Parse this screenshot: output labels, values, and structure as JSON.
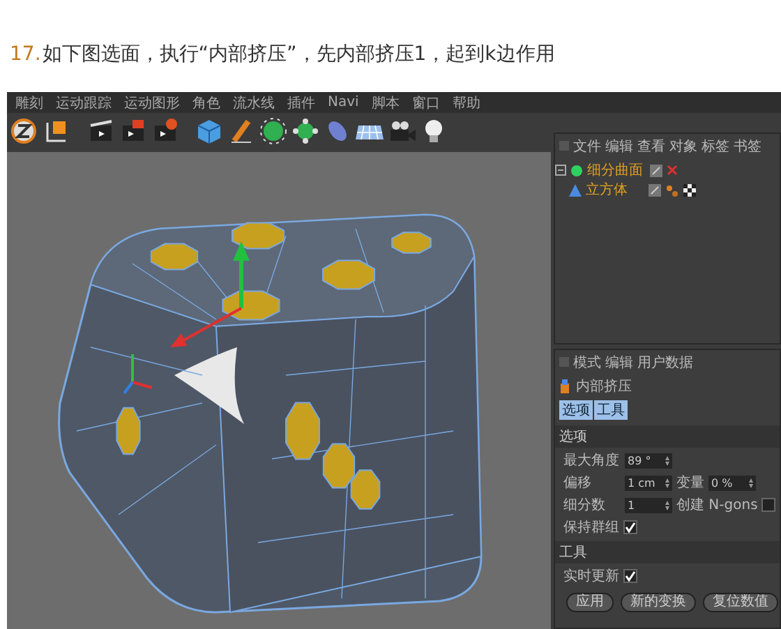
{
  "caption": {
    "number": "17.",
    "text": "如下图选面，执行“内部挤压”，先内部挤压1，起到k边作用"
  },
  "menu_bar": [
    "雕刻",
    "运动跟踪",
    "运动图形",
    "角色",
    "流水线",
    "插件",
    "Navi",
    "脚本",
    "窗口",
    "帮助"
  ],
  "object_manager": {
    "menu": [
      "文件",
      "编辑",
      "查看",
      "对象",
      "标签",
      "书签"
    ],
    "objects": [
      {
        "name": "细分曲面",
        "expanded": true,
        "children": [
          {
            "name": "立方体"
          }
        ]
      }
    ]
  },
  "attributes": {
    "menu": [
      "模式",
      "编辑",
      "用户数据"
    ],
    "title": "内部挤压",
    "tabs": [
      {
        "label": "选项",
        "selected": true
      },
      {
        "label": "工具",
        "selected": true
      }
    ],
    "sections": [
      {
        "title": "选项",
        "rows": [
          [
            {
              "kind": "field",
              "label": "最大角度",
              "value": "89 °"
            }
          ],
          [
            {
              "kind": "field",
              "label": "偏移",
              "value": "1 cm"
            },
            {
              "kind": "field",
              "label": "变量",
              "value": "0 %"
            }
          ],
          [
            {
              "kind": "field",
              "label": "细分数",
              "value": "1"
            },
            {
              "kind": "checkbox",
              "label": "创建 N-gons",
              "checked": false
            }
          ],
          [
            {
              "kind": "checkbox",
              "label": "保持群组",
              "checked": true
            }
          ]
        ]
      },
      {
        "title": "工具",
        "rows": [
          [
            {
              "kind": "checkbox",
              "label": "实时更新",
              "checked": true
            }
          ]
        ]
      }
    ],
    "buttons": [
      "应用",
      "新的变换",
      "复位数值"
    ]
  }
}
